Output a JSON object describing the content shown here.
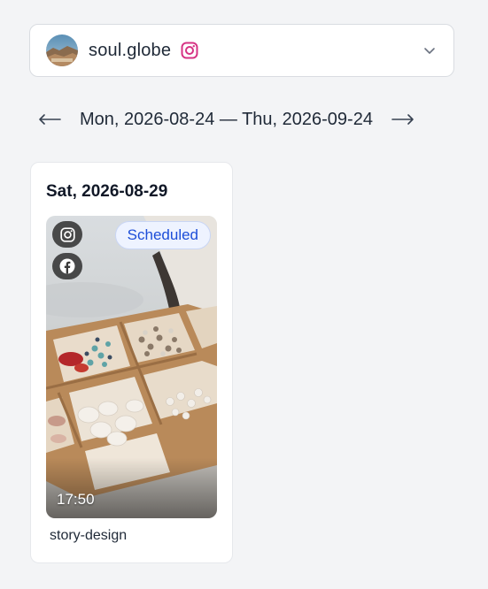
{
  "account": {
    "name": "soul.globe",
    "platform_icon": "instagram-icon",
    "brand_color": "#d63384",
    "dropdown_icon": "chevron-down-icon"
  },
  "range_nav": {
    "prev_icon": "arrow-left-icon",
    "next_icon": "arrow-right-icon",
    "label": "Mon, 2026-08-24 — Thu, 2026-09-24"
  },
  "days": [
    {
      "date_label": "Sat, 2026-08-29",
      "posts": [
        {
          "networks": [
            "instagram-icon",
            "facebook-icon"
          ],
          "status": "Scheduled",
          "status_color": "#1d4ed8",
          "time": "17:50",
          "caption": "story-design",
          "image_subject": "wooden-bead-organizer-box"
        }
      ]
    }
  ]
}
